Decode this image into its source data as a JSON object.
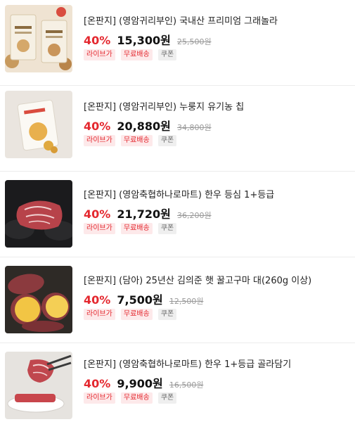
{
  "products": [
    {
      "title": "[온판지] (영암귀리부인) 국내산 프리미엄 그래놀라",
      "discount": "40%",
      "price": "15,300원",
      "original_price": "25,500원",
      "tags": [
        "라이브가",
        "무료배송",
        "쿠폰"
      ],
      "image": "granola-package-icon"
    },
    {
      "title": "[온판지] (영암귀리부인) 누룽지 유기농 칩",
      "discount": "40%",
      "price": "20,880원",
      "original_price": "34,800원",
      "tags": [
        "라이브가",
        "무료배송",
        "쿠폰"
      ],
      "image": "nurungji-chip-pack-icon"
    },
    {
      "title": "[온판지] (영암축협하나로마트) 한우 등심 1+등급",
      "discount": "40%",
      "price": "21,720원",
      "original_price": "36,200원",
      "tags": [
        "라이브가",
        "무료배송",
        "쿠폰"
      ],
      "image": "beef-sirloin-icon"
    },
    {
      "title": "[온판지] (담아) 25년산 김의준 햇 꿀고구마 대(260g 이상)",
      "discount": "40%",
      "price": "7,500원",
      "original_price": "12,500원",
      "tags": [
        "라이브가",
        "무료배송",
        "쿠폰"
      ],
      "image": "sweet-potato-icon"
    },
    {
      "title": "[온판지] (영암축협하나로마트) 한우 1+등급 골라담기",
      "discount": "40%",
      "price": "9,900원",
      "original_price": "16,500원",
      "tags": [
        "라이브가",
        "무료배송",
        "쿠폰"
      ],
      "image": "beef-plate-icon"
    }
  ],
  "colors": {
    "discount": "#e4282f",
    "tag_bg": "#fde9ea",
    "coupon_bg": "#efefef"
  }
}
